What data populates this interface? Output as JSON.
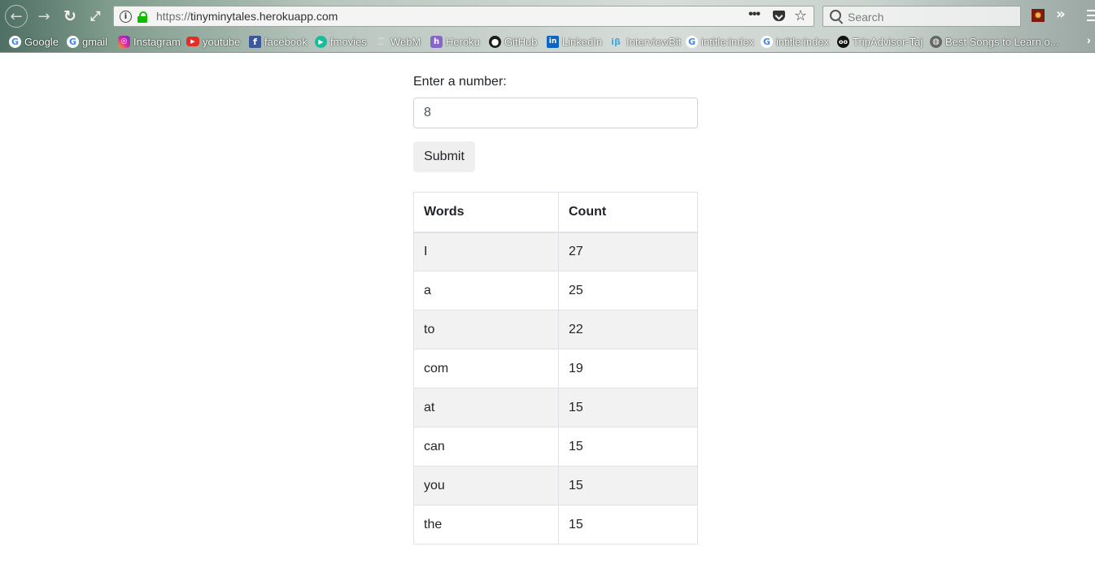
{
  "browser": {
    "url_protocol": "https://",
    "url_host": "tinyminytales.herokuapp.com",
    "search_placeholder": "Search",
    "bookmarks": [
      {
        "label": "Google",
        "icon": "google-icon"
      },
      {
        "label": "gmail",
        "icon": "google-icon"
      },
      {
        "label": "Instagram",
        "icon": "instagram-icon"
      },
      {
        "label": "youtube",
        "icon": "youtube-icon"
      },
      {
        "label": "facebook",
        "icon": "facebook-icon"
      },
      {
        "label": "fmovies",
        "icon": "fmovies-icon"
      },
      {
        "label": "WebM",
        "icon": "webm-icon"
      },
      {
        "label": "Heroku",
        "icon": "heroku-icon"
      },
      {
        "label": "GitHub",
        "icon": "github-icon"
      },
      {
        "label": "LinkedIn",
        "icon": "linkedin-icon"
      },
      {
        "label": "InterviewBit",
        "icon": "interviewbit-icon"
      },
      {
        "label": "intitle:index",
        "icon": "google-icon"
      },
      {
        "label": "intitle:index",
        "icon": "google-icon"
      },
      {
        "label": "TripAdvisor-Taj",
        "icon": "tripadvisor-icon"
      },
      {
        "label": "Best Songs to Learn o...",
        "icon": "globe-icon"
      }
    ]
  },
  "form": {
    "label": "Enter a number:",
    "input_value": "8",
    "submit_label": "Submit"
  },
  "table": {
    "headers": [
      "Words",
      "Count"
    ],
    "rows": [
      [
        "I",
        "27"
      ],
      [
        "a",
        "25"
      ],
      [
        "to",
        "22"
      ],
      [
        "com",
        "19"
      ],
      [
        "at",
        "15"
      ],
      [
        "can",
        "15"
      ],
      [
        "you",
        "15"
      ],
      [
        "the",
        "15"
      ]
    ]
  }
}
